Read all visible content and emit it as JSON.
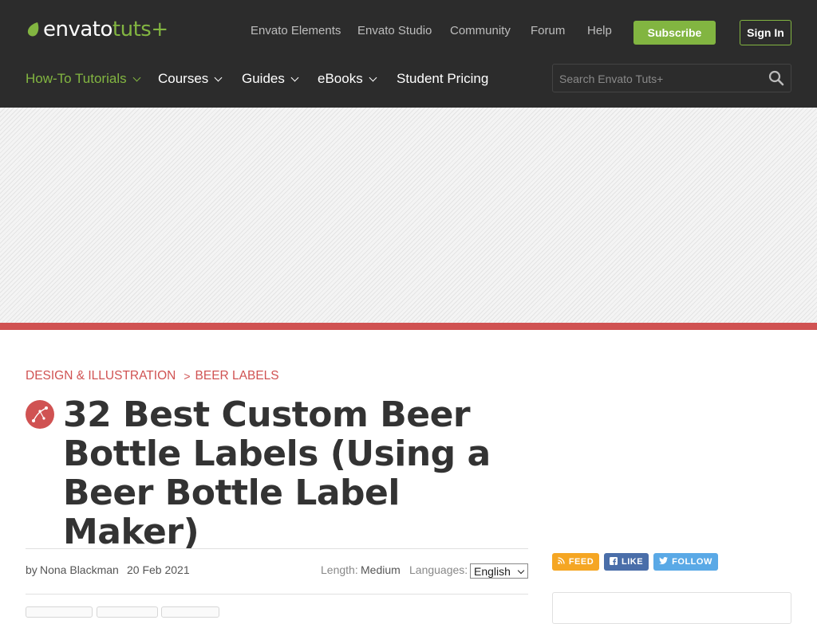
{
  "header": {
    "logo_brand": "envato",
    "logo_suffix": "tuts+",
    "top_links": [
      "Envato Elements",
      "Envato Studio",
      "Community",
      "Forum",
      "Help"
    ],
    "subscribe_label": "Subscribe",
    "signin_label": "Sign In",
    "main_nav": [
      {
        "label": "How-To Tutorials",
        "active": true
      },
      {
        "label": "Courses"
      },
      {
        "label": "Guides"
      },
      {
        "label": "eBooks"
      },
      {
        "label": "Student Pricing"
      }
    ],
    "search_placeholder": "Search Envato Tuts+"
  },
  "breadcrumbs": [
    "DESIGN & ILLUSTRATION",
    "BEER LABELS"
  ],
  "breadcrumb_separator": ">",
  "article": {
    "title_lines": [
      "32 Best Custom Beer",
      "Bottle Labels (Using a",
      "Beer Bottle Label Maker)"
    ],
    "by_label": "by",
    "author": "Nona Blackman",
    "date": "20 Feb 2021",
    "length_label": "Length:",
    "length_value": "Medium",
    "languages_label": "Languages:",
    "language_selected": "English"
  },
  "social": {
    "feed": "FEED",
    "like": "LIKE",
    "follow": "FOLLOW"
  },
  "colors": {
    "header_bg": "#2c2c2c",
    "accent_green": "#82b541",
    "accent_red": "#d05252",
    "link_blue": "#1f7aa8",
    "feed_orange": "#f5a623",
    "like_blue": "#4a6ea9",
    "follow_blue": "#5aa9e6"
  }
}
